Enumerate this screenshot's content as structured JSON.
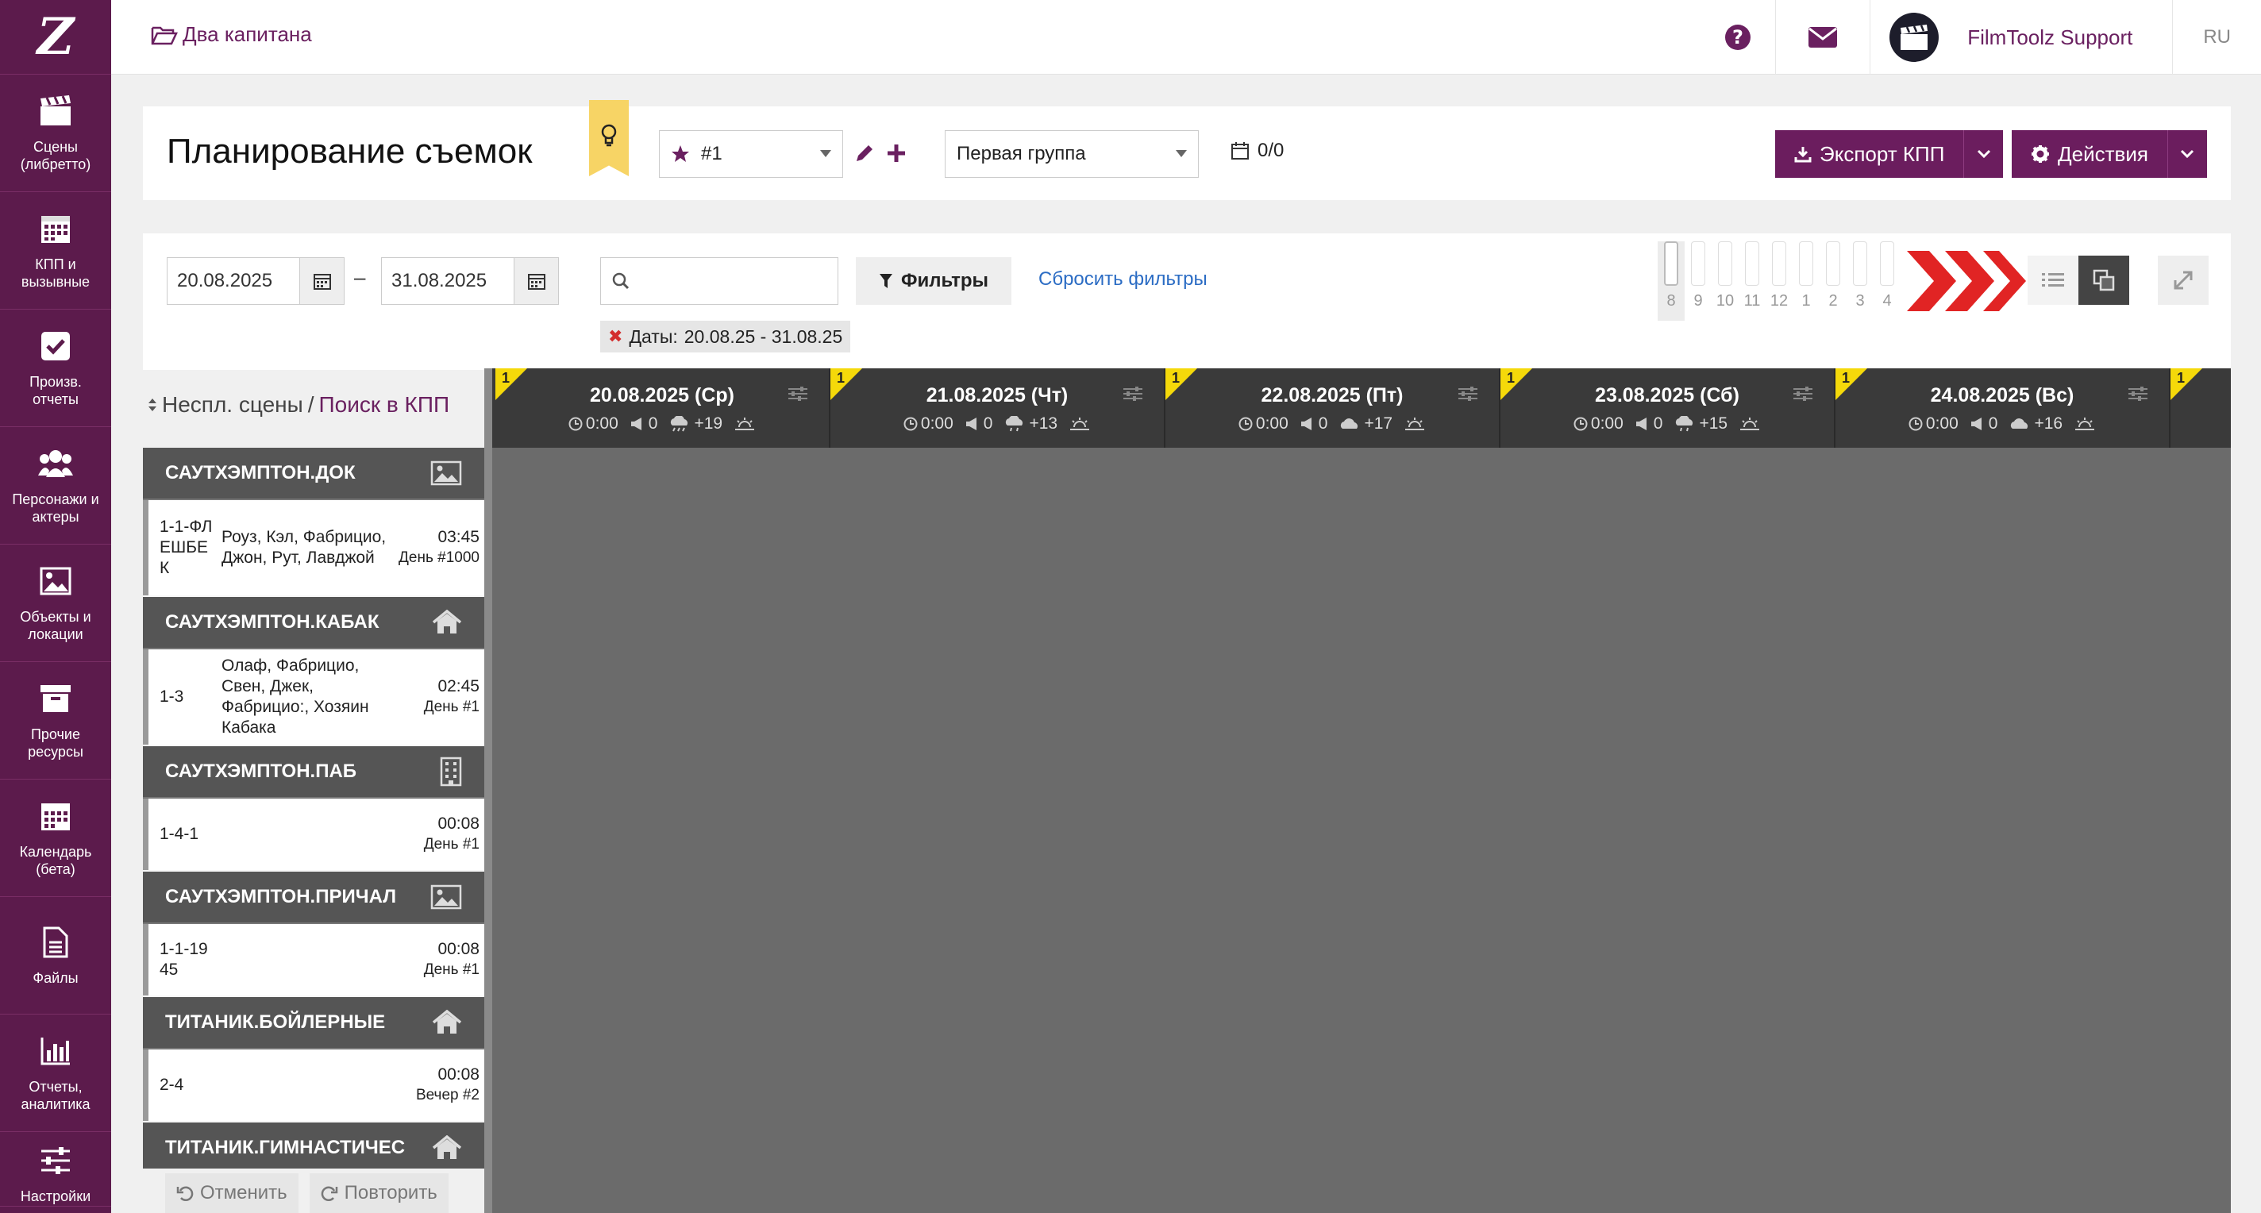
{
  "sidebar": {
    "logo": "Z",
    "items": [
      {
        "label": "Сцены (либретто)"
      },
      {
        "label": "КПП и вызывные"
      },
      {
        "label": "Произв. отчеты"
      },
      {
        "label": "Персонажи и актеры"
      },
      {
        "label": "Объекты и локации"
      },
      {
        "label": "Прочие ресурсы"
      },
      {
        "label": "Календарь (бета)"
      },
      {
        "label": "Файлы"
      },
      {
        "label": "Отчеты, аналитика"
      },
      {
        "label": "Настройки"
      }
    ]
  },
  "topbar": {
    "project": "Два капитана",
    "user": "FilmToolz Support",
    "lang": "RU"
  },
  "header": {
    "title": "Планирование съемок",
    "version": "#1",
    "group": "Первая группа",
    "counter": "0/0",
    "export_label": "Экспорт КПП",
    "actions_label": "Действия"
  },
  "filters": {
    "date_from": "20.08.2025",
    "date_to": "31.08.2025",
    "dash": "–",
    "search_value": "",
    "filters_label": "Фильтры",
    "reset_label": "Сбросить фильтры",
    "chip_label": "Даты:",
    "chip_value": "20.08.25 - 31.08.25",
    "zoom_levels": [
      "8",
      "9",
      "10",
      "11",
      "12",
      "1",
      "2",
      "3",
      "4"
    ],
    "zoom_active": "8"
  },
  "unused": {
    "label": "Неспл. сцены",
    "sep": "/",
    "link": "Поиск в КПП"
  },
  "locations": [
    {
      "name": "САУТХЭМПТОН.ДОК",
      "icon": "image-icon",
      "scenes": [
        {
          "num": "1-1-ФЛЕШБЕК",
          "who": "Роуз, Кэл, Фабрицио, Джон, Рут, Лавджой",
          "time": "03:45",
          "day": "День #1000"
        }
      ]
    },
    {
      "name": "САУТХЭМПТОН.КАБАК",
      "icon": "home-icon",
      "scenes": [
        {
          "num": "1-3",
          "who": "Олаф, Фабрицио, Свен, Джек, Фабрицио:, Хозяин Кабака",
          "time": "02:45",
          "day": "День #1"
        }
      ]
    },
    {
      "name": "САУТХЭМПТОН.ПАБ",
      "icon": "building-icon",
      "scenes": [
        {
          "num": "1-4-1",
          "who": "",
          "time": "00:08",
          "day": "День #1"
        }
      ]
    },
    {
      "name": "САУТХЭМПТОН.ПРИЧАЛ",
      "icon": "image-icon",
      "scenes": [
        {
          "num": "1-1-1945",
          "who": "",
          "time": "00:08",
          "day": "День #1"
        }
      ]
    },
    {
      "name": "ТИТАНИК.БОЙЛЕРНЫЕ",
      "icon": "home-icon",
      "scenes": [
        {
          "num": "2-4",
          "who": "",
          "time": "00:08",
          "day": "Вечер #2"
        }
      ]
    },
    {
      "name": "ТИТАНИК.ГИМНАСТИЧЕС",
      "icon": "home-icon",
      "scenes": []
    }
  ],
  "undo": {
    "undo_label": "Отменить",
    "redo_label": "Повторить"
  },
  "days": [
    {
      "date": "20.08.2025 (Ср)",
      "count": "1",
      "time": "0:00",
      "scenes": "0",
      "temp": "+19",
      "weather": "rain-icon"
    },
    {
      "date": "21.08.2025 (Чт)",
      "count": "1",
      "time": "0:00",
      "scenes": "0",
      "temp": "+13",
      "weather": "cloud-rain-icon"
    },
    {
      "date": "22.08.2025 (Пт)",
      "count": "1",
      "time": "0:00",
      "scenes": "0",
      "temp": "+17",
      "weather": "cloud-icon"
    },
    {
      "date": "23.08.2025 (Сб)",
      "count": "1",
      "time": "0:00",
      "scenes": "0",
      "temp": "+15",
      "weather": "cloud-rain-icon"
    },
    {
      "date": "24.08.2025 (Вс)",
      "count": "1",
      "time": "0:00",
      "scenes": "0",
      "temp": "+16",
      "weather": "cloud-icon"
    },
    {
      "date": "",
      "count": "1",
      "time": "",
      "scenes": "",
      "temp": "",
      "weather": ""
    }
  ],
  "colors": {
    "sidebar": "#5c1b4c",
    "accent": "#6b1d5e",
    "link": "#2b6cc4",
    "day_flag": "#f5d90a"
  }
}
